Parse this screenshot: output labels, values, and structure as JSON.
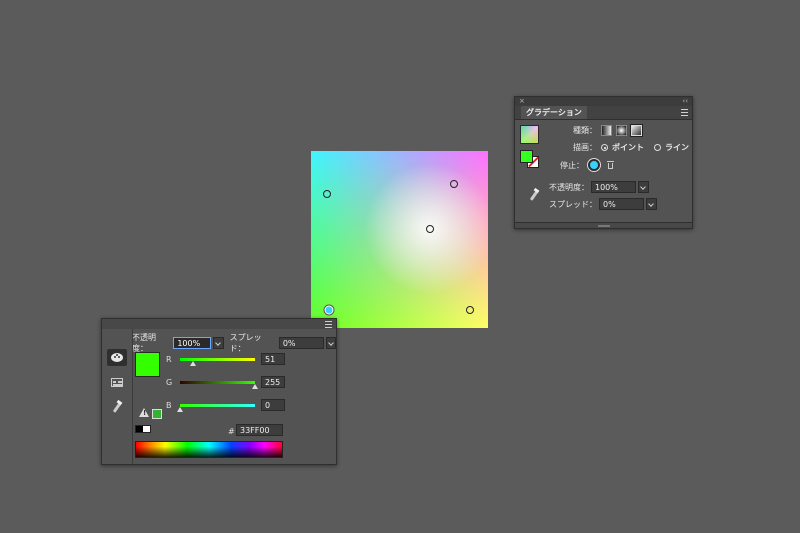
{
  "colors": {
    "background": "#5b5b5b",
    "fill_color": "#33ff00",
    "gradient_top_left": "#3ff7ff",
    "gradient_top_right": "#ff6fff",
    "gradient_bottom_left": "#66ff22",
    "gradient_bottom_right": "#ffff66"
  },
  "gradient_panel": {
    "tab_label": "グラデーション",
    "type_label": "種類：",
    "draw_label": "描画：",
    "draw_point_option": "ポイント",
    "draw_line_option": "ライン",
    "stop_label": "停止：",
    "opacity_label": "不透明度：",
    "opacity_value": "100%",
    "spread_label": "スプレッド：",
    "spread_value": "0%",
    "icons": [
      "close-icon",
      "collapse-icon",
      "panel-menu-icon",
      "gradient-swatch",
      "fill-swatch",
      "stroke-swatch",
      "linear-gradient-icon",
      "radial-gradient-icon",
      "freeform-gradient-icon",
      "trash-icon",
      "eyedropper-icon"
    ]
  },
  "color_panel": {
    "opacity_label": "不透明度：",
    "opacity_value": "100%",
    "spread_label": "スプレッド：",
    "spread_value": "0%",
    "r_label": "R",
    "r_value": "51",
    "g_label": "G",
    "g_value": "255",
    "b_label": "B",
    "b_value": "0",
    "hex_label": "#",
    "hex_value": "33FF00",
    "icons": [
      "palette-icon",
      "swatches-icon",
      "eyedropper-icon",
      "out-of-gamut-warning-icon",
      "panel-menu-icon",
      "chevron-right-icon",
      "chevron-down-icon"
    ]
  }
}
